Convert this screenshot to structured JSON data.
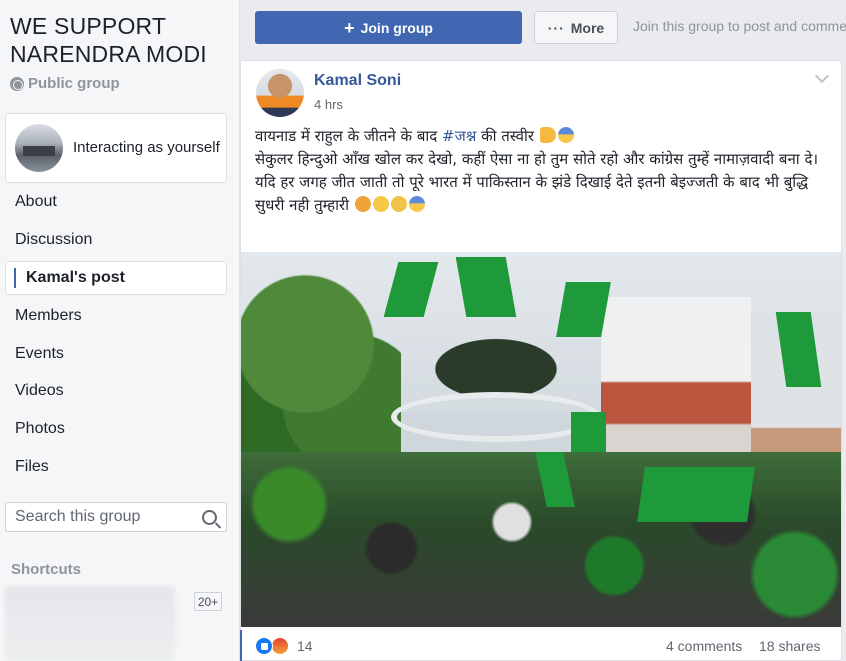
{
  "sidebar": {
    "group_title": "WE SUPPORT NARENDRA MODI",
    "privacy": "Public group",
    "interacting": "Interacting as yourself",
    "nav": [
      {
        "label": "About"
      },
      {
        "label": "Discussion"
      },
      {
        "label": "Kamal's post",
        "active": true
      },
      {
        "label": "Members"
      },
      {
        "label": "Events"
      },
      {
        "label": "Videos"
      },
      {
        "label": "Photos"
      },
      {
        "label": "Files"
      }
    ],
    "search_placeholder": "Search this group",
    "shortcuts_label": "Shortcuts",
    "shortcut_badge": "20+"
  },
  "actions": {
    "join_label": "Join group",
    "more_label": "More",
    "join_hint": "Join this group to post and comment."
  },
  "post": {
    "author": "Kamal Soni",
    "time": "4 hrs",
    "line1_a": "वायनाड में राहुल के जीतने के बाद ",
    "hashtag": "#जश्न",
    "line1_b": " की तस्वीर",
    "line2": "सेकुलर हिन्दुओ आँख खोल कर देखो, कहीं ऐसा ना हो तुम सोते रहो और कांग्रेस तुम्हें नामाज़वादी बना दे।",
    "line3": "यदि हर जगह जीत जाती तो पूरे भारत में पाकिस्तान के झंडे दिखाई देते इतनी बेइज्जती के बाद भी बुद्धि सुधरी नही तुम्हारी",
    "reaction_count": "14",
    "comments": "4 comments",
    "shares": "18 shares"
  },
  "colors": {
    "brand": "#4267b2",
    "link": "#365899"
  }
}
